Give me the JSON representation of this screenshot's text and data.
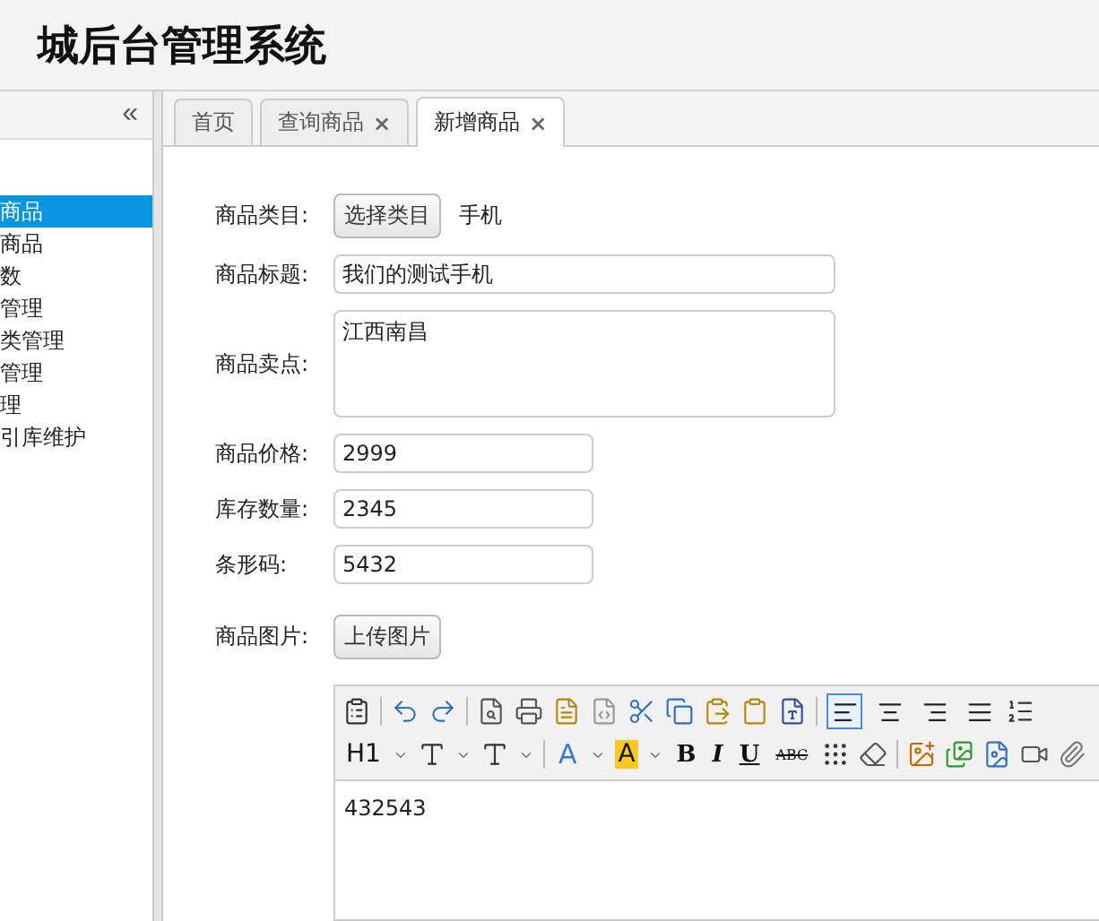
{
  "header": {
    "title": "城后台管理系统"
  },
  "sidebar": {
    "collapse": "«",
    "items": [
      {
        "label": "商品",
        "selected": true
      },
      {
        "label": "商品",
        "selected": false
      },
      {
        "label": "数",
        "selected": false
      },
      {
        "label": "管理",
        "selected": false
      },
      {
        "label": "类管理",
        "selected": false
      },
      {
        "label": "管理",
        "selected": false
      },
      {
        "label": "理",
        "selected": false
      },
      {
        "label": "引库维护",
        "selected": false
      }
    ]
  },
  "tabs": [
    {
      "label": "首页",
      "closable": false,
      "selected": false
    },
    {
      "label": "查询商品",
      "closable": true,
      "selected": false
    },
    {
      "label": "新增商品",
      "closable": true,
      "selected": true
    }
  ],
  "close_mark": "×",
  "form": {
    "rows": [
      {
        "kind": "category",
        "label": "商品类目:",
        "button": "选择类目",
        "value": "手机"
      },
      {
        "kind": "wide",
        "label": "商品标题:",
        "value": "我们的测试手机"
      },
      {
        "kind": "area",
        "label": "商品卖点:",
        "value": "江西南昌"
      },
      {
        "kind": "narrow",
        "label": "商品价格:",
        "value": "2999"
      },
      {
        "kind": "narrow",
        "label": "库存数量:",
        "value": "2345"
      },
      {
        "kind": "narrow",
        "label": "条形码:",
        "value": "5432"
      },
      {
        "kind": "upload",
        "label": "商品图片:",
        "button": "上传图片"
      }
    ]
  },
  "editor": {
    "align_buttons": [
      {
        "selected": true
      },
      {
        "selected": false
      },
      {
        "selected": false
      },
      {
        "selected": false
      }
    ],
    "format_labels": [
      "H1",
      "A",
      "A",
      "B",
      "I",
      "U",
      "ABC"
    ],
    "content": "432543"
  }
}
